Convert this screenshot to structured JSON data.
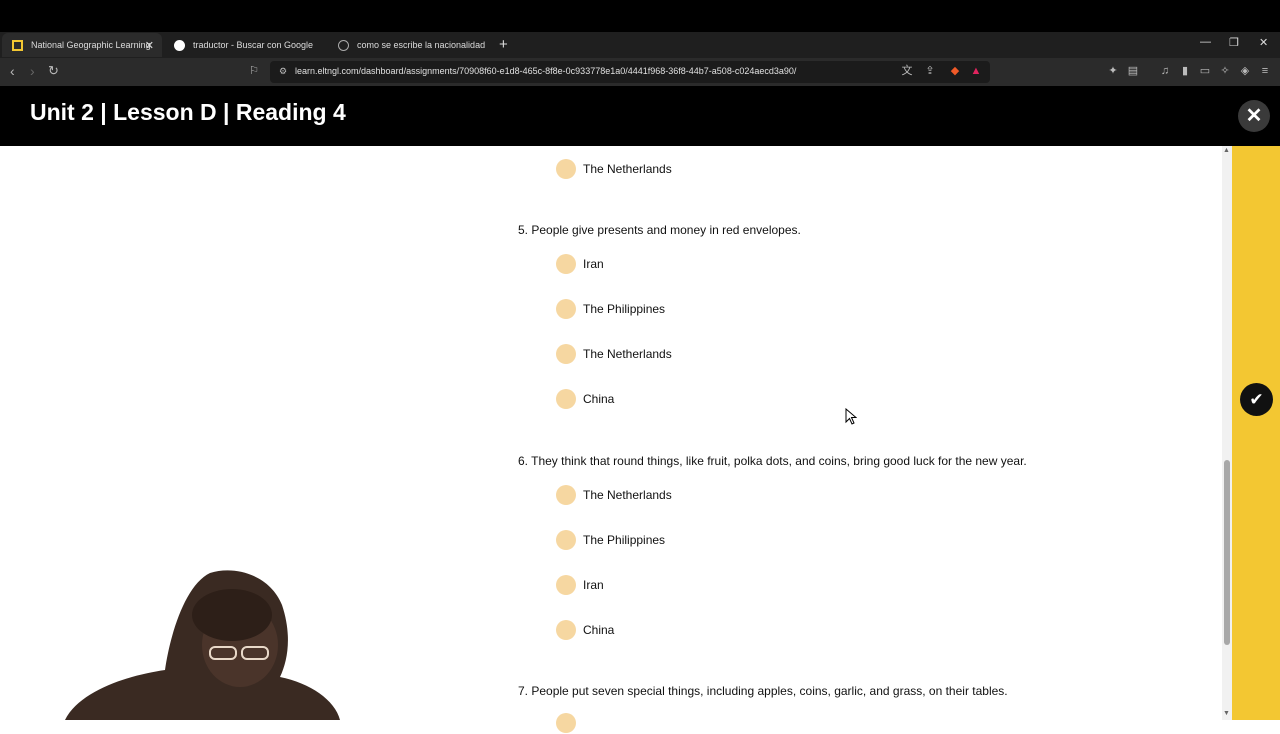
{
  "browser": {
    "tabs": [
      {
        "label": "National Geographic Learning",
        "active": true
      },
      {
        "label": "traductor - Buscar con Google",
        "active": false
      },
      {
        "label": "como se escribe la nacionalidad de ir",
        "active": false
      }
    ],
    "url": "learn.eltngl.com/dashboard/assignments/70908f60-e1d8-465c-8f8e-0c933778e1a0/4441f968-36f8-44b7-a508-c024aecd3a90/"
  },
  "header": {
    "title": "Unit 2 | Lesson D | Reading 4"
  },
  "quiz": {
    "prev_option": "The Netherlands",
    "questions": [
      {
        "prompt": "5.  People give presents and money in red envelopes.",
        "options": [
          "Iran",
          "The Philippines",
          "The Netherlands",
          "China"
        ]
      },
      {
        "prompt": "6.  They think that round things, like fruit, polka dots, and coins, bring good luck for the new year.",
        "options": [
          "The Netherlands",
          "The Philippines",
          "Iran",
          "China"
        ]
      },
      {
        "prompt": "7.  People put seven special things, including apples, coins, garlic, and grass, on their tables.",
        "options": []
      }
    ]
  },
  "colors": {
    "accent": "#f3c732",
    "radio": "#f6d7a1",
    "header": "#000000"
  }
}
